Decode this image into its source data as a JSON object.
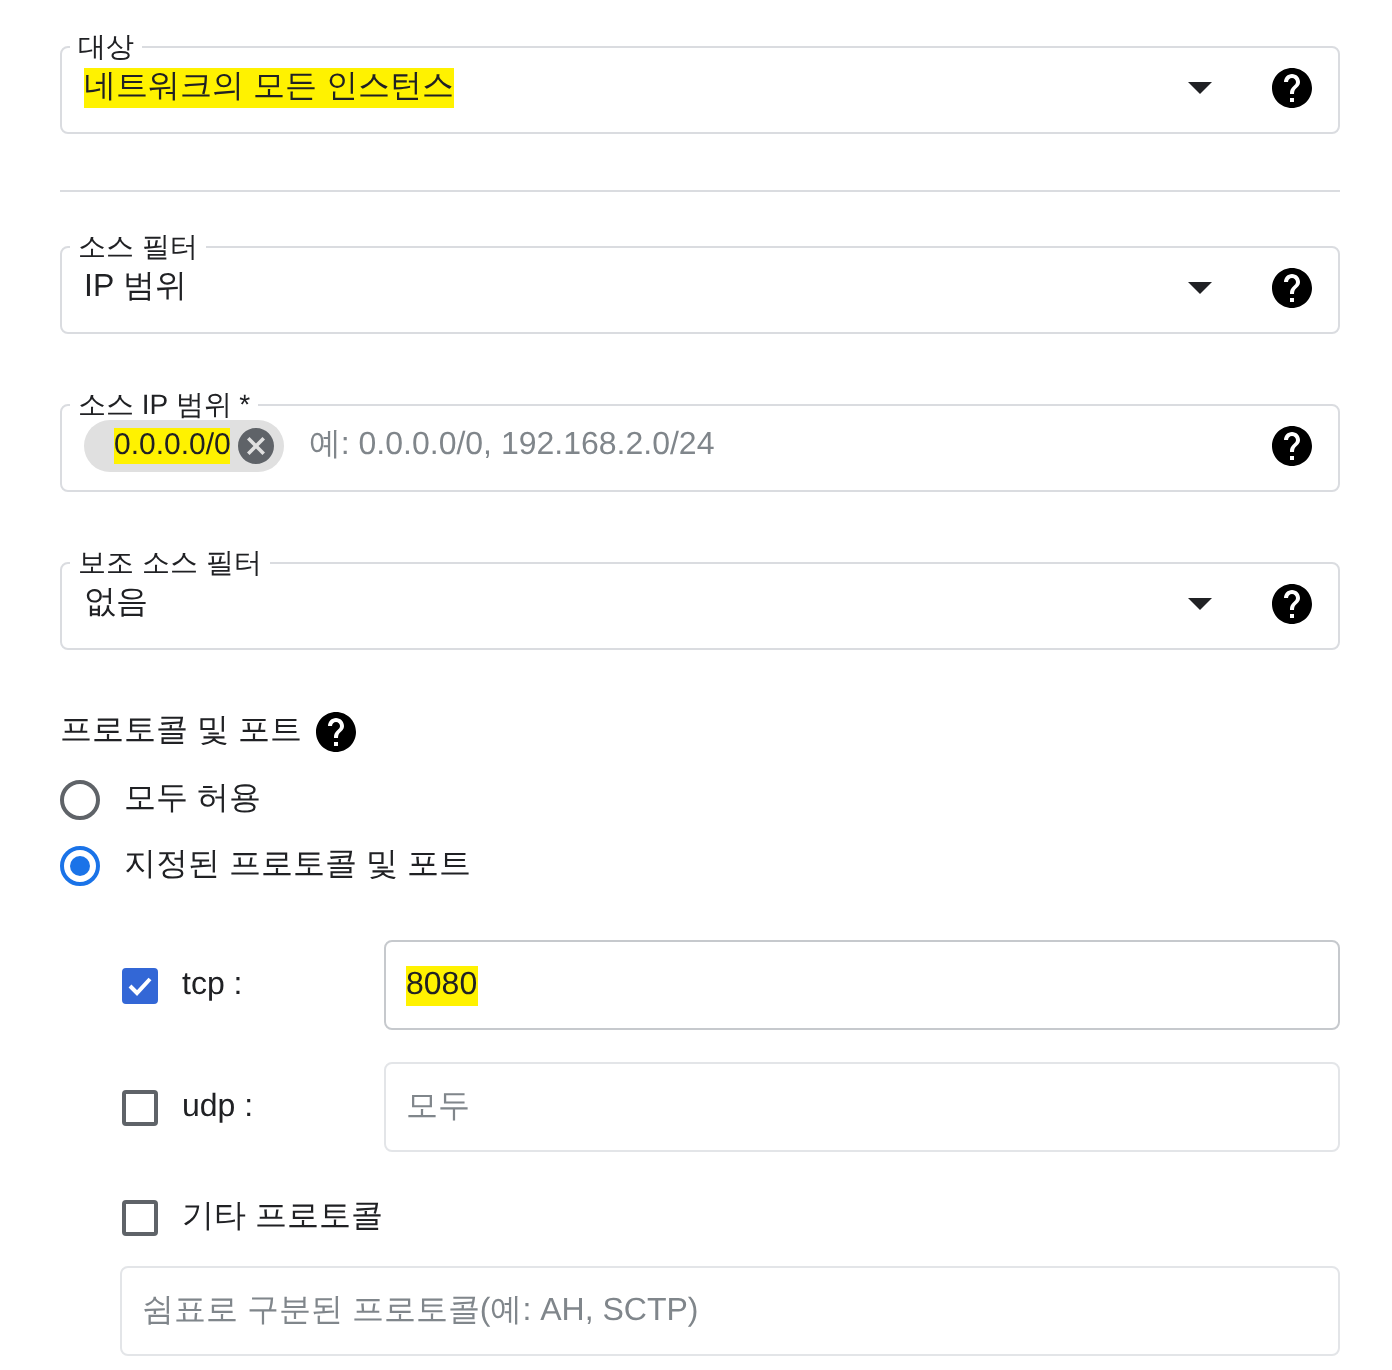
{
  "target_field": {
    "kind": "select",
    "label": "대상",
    "value": "네트워크의 모든 인스턴스",
    "highlighted": true
  },
  "source_fields": [
    {
      "kind": "select",
      "label": "소스 필터",
      "value": "IP 범위"
    },
    {
      "kind": "chips",
      "label": "소스 IP 범위 *",
      "chips": [
        {
          "text": "0.0.0.0/0",
          "highlighted": true
        }
      ],
      "placeholder": "예: 0.0.0.0/0, 192.168.2.0/24"
    },
    {
      "kind": "select",
      "label": "보조 소스 필터",
      "value": "없음"
    }
  ],
  "protocols": {
    "title": "프로토콜 및 포트",
    "options": [
      {
        "label": "모두 허용",
        "selected": false
      },
      {
        "label": "지정된 프로토콜 및 포트",
        "selected": true
      }
    ],
    "entries": [
      {
        "kind": "port",
        "label": "tcp :",
        "checked": true,
        "value": "8080",
        "highlighted": true
      },
      {
        "kind": "port",
        "label": "udp :",
        "checked": false,
        "placeholder": "모두"
      },
      {
        "kind": "other",
        "label": "기타 프로토콜",
        "checked": false,
        "placeholder": "쉼표로 구분된 프로토콜(예: AH, SCTP)"
      }
    ]
  }
}
